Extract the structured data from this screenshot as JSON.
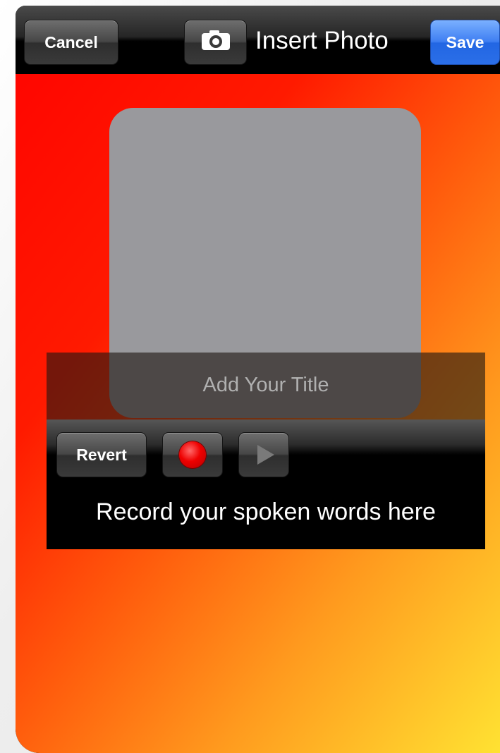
{
  "toolbar": {
    "cancel_label": "Cancel",
    "camera_icon": "camera-icon",
    "title": "Insert Photo",
    "save_label": "Save"
  },
  "photo": {
    "title_placeholder": "Add Your Title"
  },
  "audio": {
    "revert_label": "Revert",
    "record_icon": "record-icon",
    "play_icon": "play-icon",
    "caption": "Record your spoken words here"
  },
  "colors": {
    "save_accent": "#2b6fe8",
    "record_red": "#ee0000",
    "background_start": "#ff0600",
    "background_end": "#ffe232"
  }
}
